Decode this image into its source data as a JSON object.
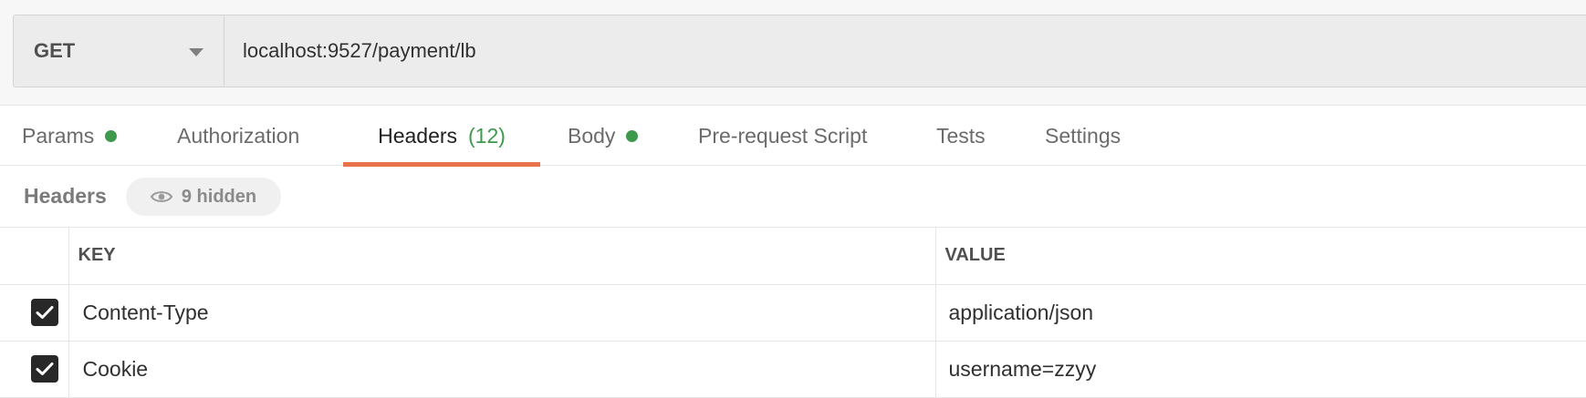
{
  "request": {
    "method": "GET",
    "url": "localhost:9527/payment/lb"
  },
  "tabs": [
    {
      "label": "Params",
      "dot": true
    },
    {
      "label": "Authorization"
    },
    {
      "label": "Headers",
      "count": "(12)",
      "active": true
    },
    {
      "label": "Body",
      "dot": true
    },
    {
      "label": "Pre-request Script"
    },
    {
      "label": "Tests"
    },
    {
      "label": "Settings"
    }
  ],
  "headers_section": {
    "title": "Headers",
    "hidden_label": "9 hidden"
  },
  "table": {
    "columns": [
      "KEY",
      "VALUE"
    ],
    "rows": [
      {
        "checked": true,
        "key": "Content-Type",
        "value": "application/json"
      },
      {
        "checked": true,
        "key": "Cookie",
        "value": "username=zzyy"
      }
    ]
  },
  "colors": {
    "active_underline": "#e8734a",
    "status_dot": "#3d9a4c"
  }
}
